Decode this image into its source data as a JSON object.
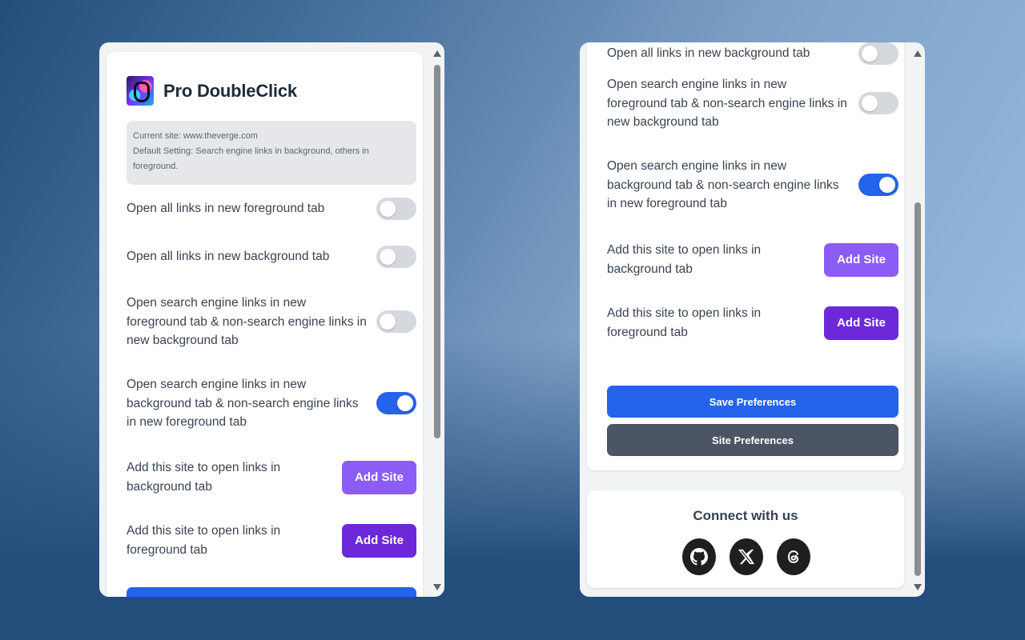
{
  "app": {
    "title": "Pro DoubleClick"
  },
  "info": {
    "current_site": "Current site: www.theverge.com",
    "default_setting": "Default Setting: Search engine links in background, others in foreground."
  },
  "options": [
    {
      "label": "Open all links in new foreground tab",
      "enabled": false
    },
    {
      "label": "Open all links in new background tab",
      "enabled": false
    },
    {
      "label": "Open search engine links in new foreground tab & non-search engine links in new background tab",
      "enabled": false
    },
    {
      "label": "Open search engine links in new background tab & non-search engine links in new foreground tab",
      "enabled": true
    }
  ],
  "site_actions": [
    {
      "label": "Add this site to open links in background tab",
      "button": "Add Site"
    },
    {
      "label": "Add this site to open links in foreground tab",
      "button": "Add Site"
    }
  ],
  "buttons": {
    "save": "Save Preferences",
    "site_prefs": "Site Preferences"
  },
  "connect": {
    "title": "Connect with us",
    "links": [
      {
        "icon": "github-icon"
      },
      {
        "icon": "x-icon"
      },
      {
        "icon": "threads-icon"
      }
    ]
  },
  "colors": {
    "toggle_on": "#2563eb",
    "toggle_off": "#d5d8dd",
    "add_site_light": "#8b5cf6",
    "add_site_dark": "#6d28d9",
    "save_button": "#2563eb",
    "site_prefs_button": "#4b5563"
  }
}
